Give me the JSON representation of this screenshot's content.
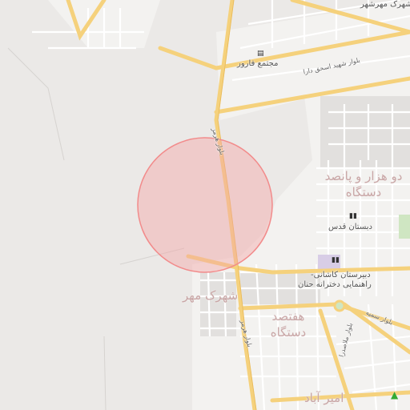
{
  "map": {
    "background": "#ebe9e7",
    "road_color": "#f5d17c",
    "highlight_circle_color": "#f28b8b",
    "place_labels": {
      "farvar_complex": "مجتمع فارور",
      "quds_school": "دبستان قدس",
      "kashani_school_line1": "دبیرستان کاشانی-",
      "kashani_school_line2": "راهنمایی دخترانه حنان",
      "mehr_town": "شهرک مهر",
      "seven_hundred_units": "هفتصد دستگاه",
      "two_thousand_five_hundred_units": "دو هزار و پانصد دستگاه",
      "amirabad": "امیر آباد",
      "mehrshahr_town": "شهرک مهرشهر"
    },
    "street_labels": {
      "hormoz_blvd": "بلوار هرمز",
      "ishaq_dara_blvd": "بلوار شهید اسحق دارا",
      "mollasadra_blvd": "بلوار ملاصدرا",
      "somayeh_blvd": "بلوار سمیه"
    },
    "icons": {
      "hotel": "hotel-icon",
      "school": "school-icon",
      "tree": "park-icon"
    }
  }
}
